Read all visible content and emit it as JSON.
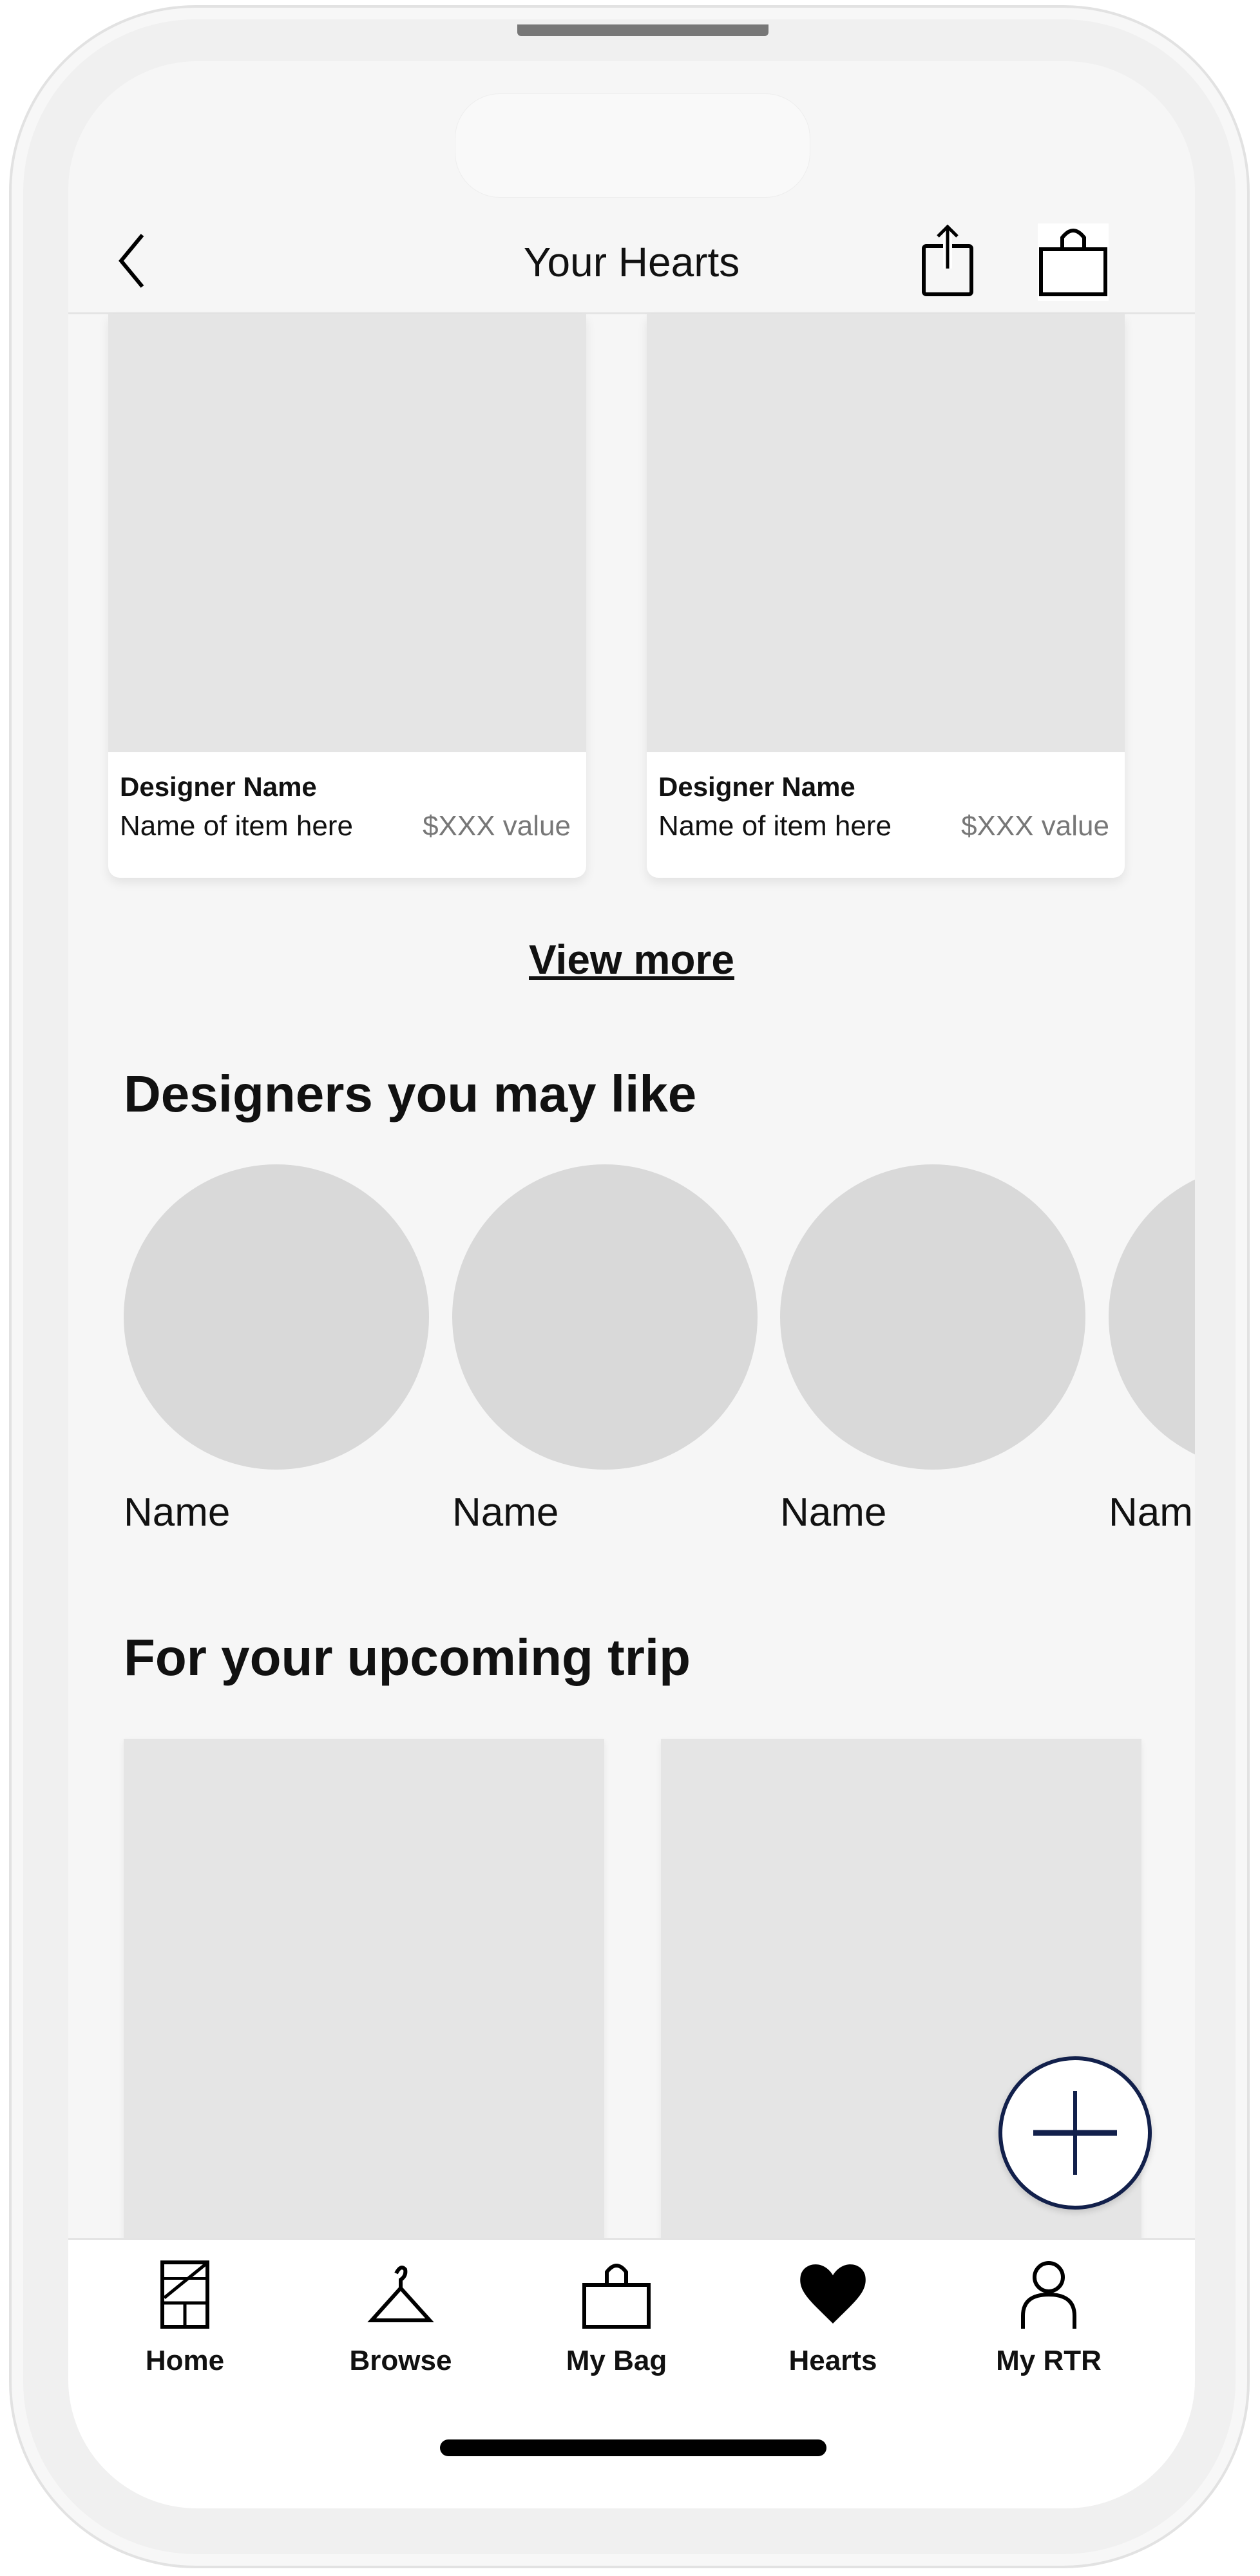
{
  "header": {
    "title": "Your Hearts",
    "back_icon": "chevron-left-icon",
    "share_icon": "share-icon",
    "bag_icon": "shopping-bag-icon"
  },
  "hearted_items": [
    {
      "designer": "Designer Name",
      "name": "Name of item here",
      "price": "$XXX value"
    },
    {
      "designer": "Designer Name",
      "name": "Name of item here",
      "price": "$XXX value"
    }
  ],
  "view_more": "View more",
  "designers_section": {
    "title": "Designers you may like",
    "designers": [
      {
        "name": "Name"
      },
      {
        "name": "Name"
      },
      {
        "name": "Name"
      },
      {
        "name": "Nam"
      }
    ]
  },
  "trip_section": {
    "title": "For your upcoming trip"
  },
  "fab": {
    "icon": "plus-icon",
    "color": "#12204b"
  },
  "bottom_nav": {
    "items": [
      {
        "label": "Home",
        "icon": "home-icon"
      },
      {
        "label": "Browse",
        "icon": "hanger-icon"
      },
      {
        "label": "My Bag",
        "icon": "bag-icon"
      },
      {
        "label": "Hearts",
        "icon": "heart-icon",
        "active": true
      },
      {
        "label": "My RTR",
        "icon": "person-icon"
      }
    ]
  },
  "peek_text": [
    "Designer Name",
    "Designer Name"
  ]
}
